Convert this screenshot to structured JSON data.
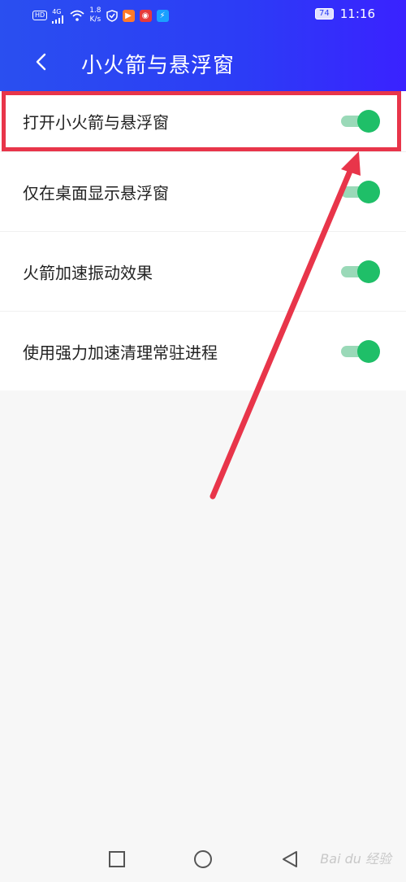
{
  "status_bar": {
    "hd": "HD",
    "network": "4G",
    "speed_value": "1.8",
    "speed_unit": "K/s",
    "battery": "74",
    "time": "11:16"
  },
  "header": {
    "back_icon": "chevron-left-icon",
    "title": "小火箭与悬浮窗"
  },
  "settings": [
    {
      "label": "打开小火箭与悬浮窗",
      "enabled": true
    },
    {
      "label": "仅在桌面显示悬浮窗",
      "enabled": true
    },
    {
      "label": "火箭加速振动效果",
      "enabled": true
    },
    {
      "label": "使用强力加速清理常驻进程",
      "enabled": true
    }
  ],
  "colors": {
    "header_start": "#2a4ff0",
    "header_end": "#3a22ff",
    "toggle_on": "#1fbf68",
    "toggle_track": "#9ad9b8",
    "annotation": "#e8354a"
  },
  "watermark": "Bai du 经验"
}
